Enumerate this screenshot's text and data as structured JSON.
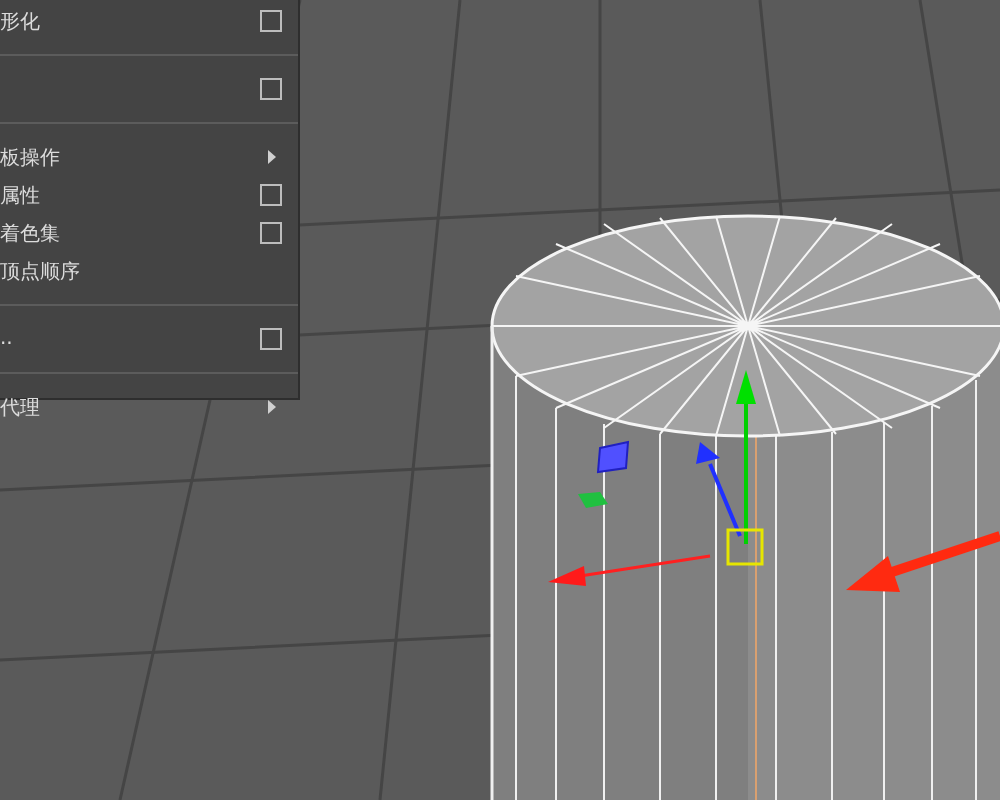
{
  "menu": {
    "items": [
      {
        "kind": "option",
        "label": "形化"
      },
      {
        "kind": "divider"
      },
      {
        "kind": "option"
      },
      {
        "kind": "divider"
      },
      {
        "kind": "submenu",
        "label": "板操作"
      },
      {
        "kind": "option",
        "label": "属性"
      },
      {
        "kind": "option",
        "label": "着色集"
      },
      {
        "kind": "plain",
        "label": "顶点顺序"
      },
      {
        "kind": "divider"
      },
      {
        "kind": "option",
        "label": ".."
      },
      {
        "kind": "divider"
      },
      {
        "kind": "submenu",
        "label": "代理"
      }
    ]
  }
}
